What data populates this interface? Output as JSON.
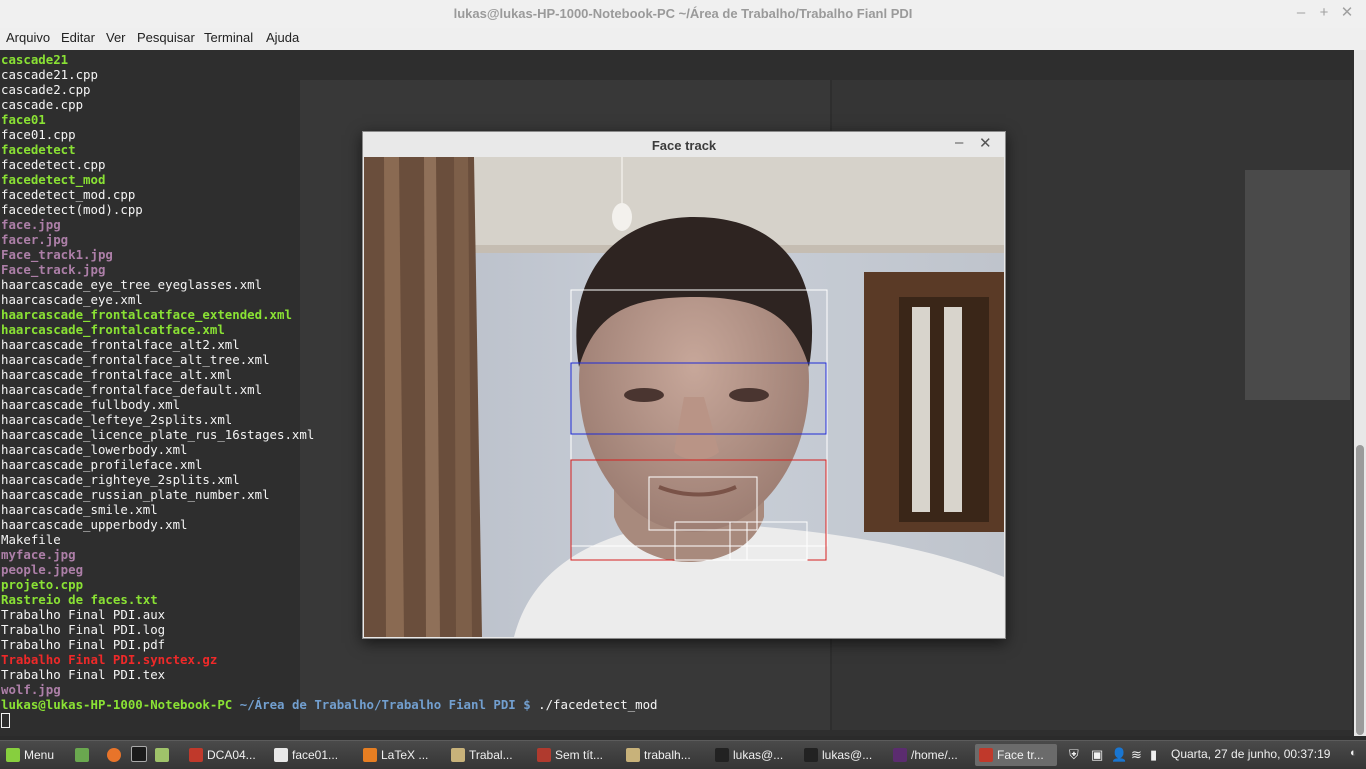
{
  "window": {
    "title": "lukas@lukas-HP-1000-Notebook-PC ~/Área de Trabalho/Trabalho Fianl PDI",
    "minimize": "–",
    "maximize": "+",
    "close": "✕"
  },
  "menu": [
    "Arquivo",
    "Editar",
    "Ver",
    "Pesquisar",
    "Terminal",
    "Ajuda"
  ],
  "terminal": {
    "files": [
      {
        "name": "cascade21",
        "kind": "exec"
      },
      {
        "name": "cascade21.cpp",
        "kind": "plain"
      },
      {
        "name": "cascade2.cpp",
        "kind": "plain"
      },
      {
        "name": "cascade.cpp",
        "kind": "plain"
      },
      {
        "name": "face01",
        "kind": "exec"
      },
      {
        "name": "face01.cpp",
        "kind": "plain"
      },
      {
        "name": "facedetect",
        "kind": "exec"
      },
      {
        "name": "facedetect.cpp",
        "kind": "plain"
      },
      {
        "name": "facedetect_mod",
        "kind": "exec"
      },
      {
        "name": "facedetect_mod.cpp",
        "kind": "plain"
      },
      {
        "name": "facedetect(mod).cpp",
        "kind": "plain"
      },
      {
        "name": "face.jpg",
        "kind": "img"
      },
      {
        "name": "facer.jpg",
        "kind": "img"
      },
      {
        "name": "Face_track1.jpg",
        "kind": "img"
      },
      {
        "name": "Face_track.jpg",
        "kind": "img"
      },
      {
        "name": "haarcascade_eye_tree_eyeglasses.xml",
        "kind": "plain"
      },
      {
        "name": "haarcascade_eye.xml",
        "kind": "plain"
      },
      {
        "name": "haarcascade_frontalcatface_extended.xml",
        "kind": "exec"
      },
      {
        "name": "haarcascade_frontalcatface.xml",
        "kind": "exec"
      },
      {
        "name": "haarcascade_frontalface_alt2.xml",
        "kind": "plain"
      },
      {
        "name": "haarcascade_frontalface_alt_tree.xml",
        "kind": "plain"
      },
      {
        "name": "haarcascade_frontalface_alt.xml",
        "kind": "plain"
      },
      {
        "name": "haarcascade_frontalface_default.xml",
        "kind": "plain"
      },
      {
        "name": "haarcascade_fullbody.xml",
        "kind": "plain"
      },
      {
        "name": "haarcascade_lefteye_2splits.xml",
        "kind": "plain"
      },
      {
        "name": "haarcascade_licence_plate_rus_16stages.xml",
        "kind": "plain"
      },
      {
        "name": "haarcascade_lowerbody.xml",
        "kind": "plain"
      },
      {
        "name": "haarcascade_profileface.xml",
        "kind": "plain"
      },
      {
        "name": "haarcascade_righteye_2splits.xml",
        "kind": "plain"
      },
      {
        "name": "haarcascade_russian_plate_number.xml",
        "kind": "plain"
      },
      {
        "name": "haarcascade_smile.xml",
        "kind": "plain"
      },
      {
        "name": "haarcascade_upperbody.xml",
        "kind": "plain"
      },
      {
        "name": "Makefile",
        "kind": "plain"
      },
      {
        "name": "myface.jpg",
        "kind": "img"
      },
      {
        "name": "people.jpeg",
        "kind": "img"
      },
      {
        "name": "projeto.cpp",
        "kind": "exec"
      },
      {
        "name": "Rastreio de faces.txt",
        "kind": "exec"
      },
      {
        "name": "Trabalho Final PDI.aux",
        "kind": "plain"
      },
      {
        "name": "Trabalho Final PDI.log",
        "kind": "plain"
      },
      {
        "name": "Trabalho Final PDI.pdf",
        "kind": "plain"
      },
      {
        "name": "Trabalho Final PDI.synctex.gz",
        "kind": "arc"
      },
      {
        "name": "Trabalho Final PDI.tex",
        "kind": "plain"
      },
      {
        "name": "wolf.jpg",
        "kind": "img"
      }
    ],
    "prompt_user": "lukas@lukas-HP-1000-Notebook-PC",
    "prompt_path": "~/Área de Trabalho/Trabalho Fianl PDI $",
    "prompt_cmd": "./facedetect_mod"
  },
  "facetrack": {
    "title": "Face track",
    "minimize": "–",
    "close": "✕"
  },
  "taskbar": {
    "menu_label": "Menu",
    "items": [
      {
        "label": "DCA04...",
        "color": "#c0392b"
      },
      {
        "label": "face01...",
        "color": "#e8e8e8"
      },
      {
        "label": "LaTeX ...",
        "color": "#e67e22"
      },
      {
        "label": "Trabal...",
        "color": "#c8b27a"
      },
      {
        "label": "Sem tít...",
        "color": "#b03a2e"
      },
      {
        "label": "trabalh...",
        "color": "#c8b27a"
      },
      {
        "label": "lukas@...",
        "color": "#222222"
      },
      {
        "label": "lukas@...",
        "color": "#222222"
      },
      {
        "label": "/home/...",
        "color": "#5b2c6f"
      },
      {
        "label": "Face tr...",
        "color": "#c0392b"
      }
    ],
    "clock": "Quarta, 27 de junho, 00:37:19"
  }
}
